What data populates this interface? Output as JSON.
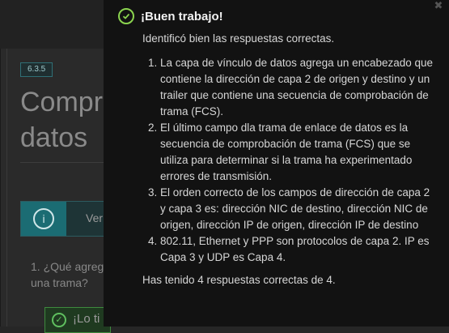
{
  "background": {
    "badge": "6.3.5",
    "title": "Compru\ndatos",
    "info_label": "Ver",
    "question": "1. ¿Qué agreg una trama?",
    "feedback": "¡Lo ti"
  },
  "modal": {
    "close_label": "✖",
    "title": "¡Buen trabajo!",
    "intro": "Identificó bien las respuestas correctas.",
    "items": [
      "La capa de vínculo de datos agrega un encabezado que contiene la dirección de capa 2 de origen y destino y un trailer que contiene una secuencia de comprobación de trama (FCS).",
      "El último campo dla trama de enlace de datos es la secuencia de comprobación de trama (FCS) que se utiliza para determinar si la trama ha experimentado errores de transmisión.",
      "El orden correcto de los campos de dirección de capa 2 y capa 3 es: dirección NIC de destino, dirección NIC de origen, dirección IP de origen, dirección IP de destino",
      "802.11, Ethernet y PPP son protocolos de capa 2. IP es Capa 3 y UDP es Capa 4."
    ],
    "summary": "Has tenido 4 respuestas correctas de 4."
  }
}
